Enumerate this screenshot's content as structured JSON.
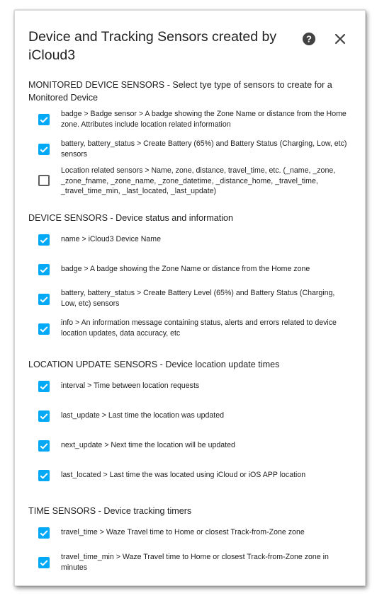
{
  "dialog": {
    "title": "Device and Tracking Sensors created by iCloud3",
    "help_icon": "question-circle-icon",
    "close_icon": "close-x-icon"
  },
  "colors": {
    "accent": "#03a9f4",
    "text": "#212121"
  },
  "sections": [
    {
      "header": "MONITORED DEVICE SENSORS - Select tye type of sensors to create for a Monitored Device",
      "items": [
        {
          "label": "badge > Badge sensor > A badge showing the Zone Name or distance from the Home zone. Attributes include location related information",
          "checked": true
        },
        {
          "label": "battery, battery_status > Create Battery (65%) and Battery Status (Charging, Low, etc) sensors",
          "checked": true
        },
        {
          "label": "Location related sensors > Name, zone, distance, travel_time, etc. (_name, _zone, _zone_fname, _zone_name, _zone_datetime, _distance_home, _travel_time, _travel_time_min, _last_located, _last_update)",
          "checked": false
        }
      ]
    },
    {
      "header": "DEVICE SENSORS - Device status and information",
      "items": [
        {
          "label": "name > iCloud3 Device Name",
          "checked": true
        },
        {
          "label": "badge > A badge showing the Zone Name or distance from the Home zone",
          "checked": true
        },
        {
          "label": "battery, battery_status > Create Battery Level (65%) and Battery Status (Charging, Low, etc) sensors",
          "checked": true
        },
        {
          "label": "info > An information message containing status, alerts and errors related to device location updates, data accuracy, etc",
          "checked": true
        }
      ]
    },
    {
      "header": "LOCATION UPDATE SENSORS - Device location update times",
      "items": [
        {
          "label": "interval > Time between location requests",
          "checked": true
        },
        {
          "label": "last_update > Last time the location was updated",
          "checked": true
        },
        {
          "label": "next_update > Next time the location will be updated",
          "checked": true
        },
        {
          "label": "last_located > Last time the was located using iCloud or iOS APP location",
          "checked": true
        }
      ]
    },
    {
      "header": "TIME SENSORS - Device tracking timers",
      "items": [
        {
          "label": "travel_time > Waze Travel time to Home or closest Track-from-Zone zone",
          "checked": true
        },
        {
          "label": "travel_time_min > Waze Travel time to Home or closest Track-from-Zone zone in minutes",
          "checked": true
        }
      ]
    }
  ]
}
